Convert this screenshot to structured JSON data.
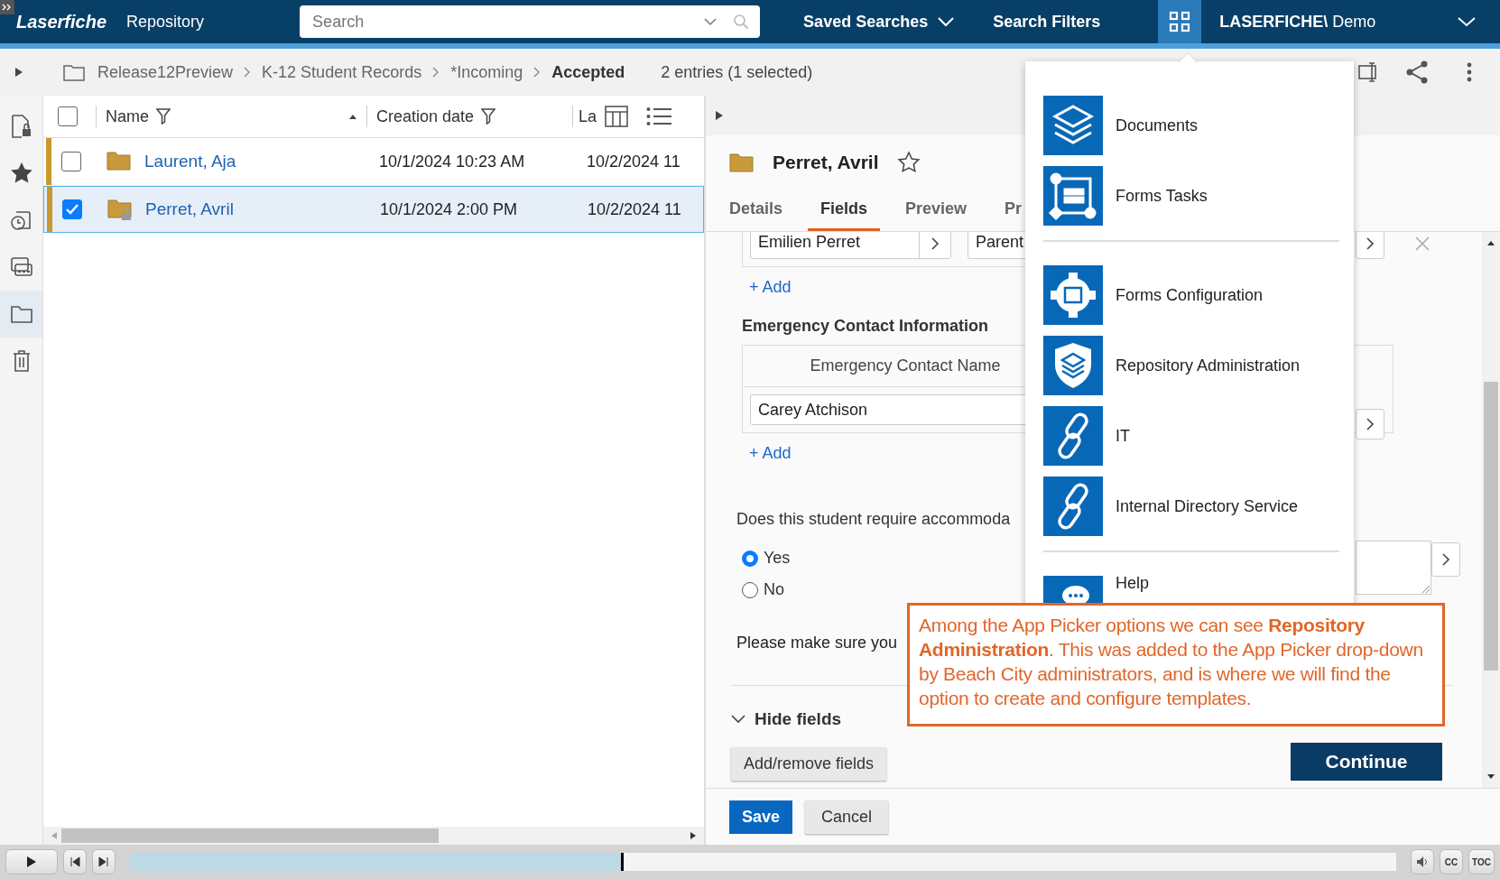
{
  "top_bar": {
    "logo": "Laserfiche",
    "app_name": "Repository",
    "search": {
      "placeholder": "Search"
    },
    "menus": [
      {
        "label": "Saved Searches",
        "caret": true
      },
      {
        "label": "Search Filters",
        "caret": false
      }
    ],
    "app_picker_button": {
      "selected": true
    },
    "user": "**LASERFICHE\\** Demo"
  },
  "breadcrumb": {
    "items": [
      "Release12Preview",
      "K-12 Student Records",
      "*Incoming",
      "Accepted"
    ],
    "entry_count": "2 entries (1 selected)"
  },
  "rail": [
    {
      "selected": false
    },
    {
      "selected": false
    },
    {
      "selected": false
    },
    {
      "selected": false
    },
    {
      "selected": true
    },
    {
      "selected": false
    }
  ],
  "table": {
    "all_checked": false,
    "columns": [
      {
        "label": "Name",
        "filter": true,
        "sorted": true
      },
      {
        "label": "Creation date",
        "filter": true,
        "sorted": false
      },
      {
        "label": "La",
        "filter": false,
        "sorted": false
      }
    ],
    "rows": [
      {
        "name": "Laurent, Aja",
        "created": "10/1/2024 10:23 AM",
        "column_3": "10/2/2024 11",
        "checked": false,
        "selected": false,
        "locked": false
      },
      {
        "name": "Perret, Avril",
        "created": "10/1/2024 2:00 PM",
        "column_3": "10/2/2024 11",
        "checked": true,
        "selected": true,
        "locked": true
      }
    ]
  },
  "details": {
    "title": "Perret, Avril",
    "starred": false,
    "tabs": [
      {
        "label": "Details",
        "selected": false
      },
      {
        "label": "Fields",
        "selected": true
      },
      {
        "label": "Preview",
        "selected": false
      },
      {
        "label": "Pr",
        "selected": false
      }
    ],
    "form": {
      "parent_values": [
        "Emilien Perret",
        "Parent"
      ],
      "add_links": [
        "+ Add",
        "+ Add"
      ],
      "section_title": "Emergency Contact Information",
      "contact_column": "Emergency Contact Name",
      "contact_value": "Carey Atchison",
      "question": "Does this student require accommoda",
      "options": [
        {
          "label": "Yes",
          "selected": true
        },
        {
          "label": "No",
          "selected": false
        }
      ],
      "note": "Please make sure you",
      "hide_fields": "Hide fields",
      "add_remove": "Add/remove fields"
    },
    "actions": [
      "Save",
      "Cancel"
    ]
  },
  "app_picker": {
    "groups": [
      [
        {
          "kind": "documents",
          "label": "Documents"
        },
        {
          "kind": "forms",
          "label": "Forms Tasks"
        }
      ],
      [
        {
          "kind": "config",
          "label": "Forms Configuration"
        },
        {
          "kind": "admin",
          "label": "Repository Administration"
        },
        {
          "kind": "link",
          "label": "IT"
        },
        {
          "kind": "link",
          "label": "Internal Directory Service"
        }
      ],
      [
        {
          "kind": "help",
          "label": "Help"
        }
      ]
    ]
  },
  "callout": {
    "text": "Among the App Picker options we can see **Repository Administration**. This was added to the App Picker drop-down by Beach City administrators, and is where we will find the option to create and configure templates."
  },
  "continue_button": "Continue",
  "player": {
    "level": 0.39,
    "buttons": [
      "CC",
      "TOC"
    ]
  }
}
